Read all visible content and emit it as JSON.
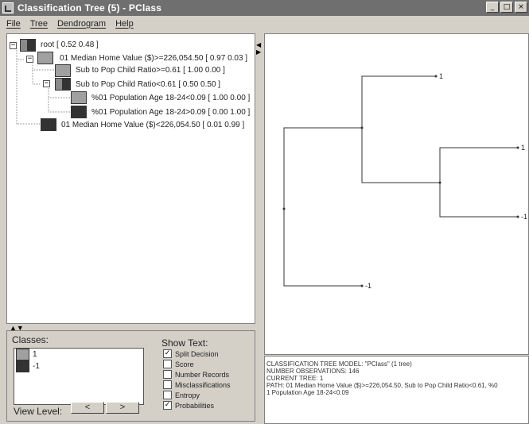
{
  "window": {
    "title": "Classification Tree (5) - PClass",
    "controls": [
      "_",
      "□",
      "×"
    ]
  },
  "menu": [
    "File",
    "Tree",
    "Dendrogram",
    "Help"
  ],
  "colors": {
    "root_swatch_left": "#8a8a8a",
    "class_1": "#a0a0a0",
    "class_minus1": "#333333"
  },
  "tree_nodes": [
    {
      "label": "root   [ 0.52  0.48 ]",
      "expander": "−"
    },
    {
      "label": "01 Median Home Value ($)>=226,054.50   [ 0.97  0.03 ]",
      "expander": "−"
    },
    {
      "label": "Sub to Pop Child Ratio>=0.61   [ 1.00  0.00 ]",
      "expander": ""
    },
    {
      "label": "Sub to Pop Child Ratio<0.61   [ 0.50  0.50 ]",
      "expander": "−"
    },
    {
      "label": "%01 Population Age 18-24<0.09   [ 1.00  0.00 ]",
      "expander": ""
    },
    {
      "label": "%01 Population Age 18-24>0.09   [ 0.00  1.00 ]",
      "expander": ""
    },
    {
      "label": "01 Median Home Value ($)<226,054.50   [ 0.01  0.99 ]",
      "expander": ""
    }
  ],
  "classes": {
    "title": "Classes:",
    "items": [
      {
        "label": "1",
        "color": "#a0a0a0"
      },
      {
        "label": "-1",
        "color": "#333333"
      }
    ]
  },
  "view_level": {
    "label": "View Level:",
    "prev": "<",
    "next": ">"
  },
  "show_text": {
    "title": "Show Text:",
    "options": [
      {
        "label": "Split Decision",
        "checked": true
      },
      {
        "label": "Score",
        "checked": false
      },
      {
        "label": "Number Records",
        "checked": false
      },
      {
        "label": "Misclassifications",
        "checked": false
      },
      {
        "label": "Entropy",
        "checked": false
      },
      {
        "label": "Probabilities",
        "checked": true
      }
    ]
  },
  "dendrogram": {
    "leaves": [
      "1",
      "1",
      "-1",
      "-1"
    ]
  },
  "info": {
    "lines": [
      "CLASSIFICATION TREE MODEL:  \"PClass\"  (1 tree)",
      "NUMBER OBSERVATIONS:  146",
      "CURRENT TREE: 1",
      "",
      "PATH:  01 Median Home Value ($)>=226,054.50, Sub to Pop Child Ratio<0.61, %0",
      "1 Population Age 18-24<0.09"
    ]
  }
}
